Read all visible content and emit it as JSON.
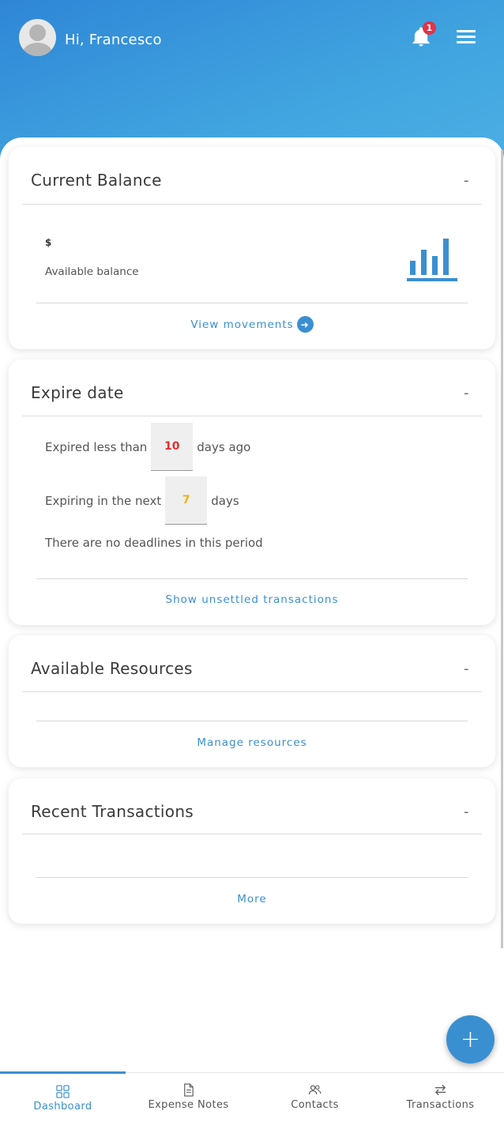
{
  "header": {
    "greeting": "Hi, Francesco",
    "notification_count": "1"
  },
  "balance_card": {
    "title": "Current Balance",
    "collapse": "-",
    "currency": "$",
    "available_label": "Available balance",
    "link": "View movements"
  },
  "expire_card": {
    "title": "Expire date",
    "collapse": "-",
    "expired_prefix": "Expired less than",
    "expired_value": "10",
    "expired_suffix": "days ago",
    "expiring_prefix": "Expiring in the next",
    "expiring_value": "7",
    "expiring_suffix": "days",
    "no_deadlines": "There are no deadlines in this period",
    "link": "Show unsettled transactions"
  },
  "resources_card": {
    "title": "Available Resources",
    "collapse": "-",
    "link": "Manage resources"
  },
  "transactions_card": {
    "title": "Recent Transactions",
    "collapse": "-",
    "link": "More"
  },
  "fab": {
    "label": "+"
  },
  "tabs": [
    {
      "label": "Dashboard",
      "icon": "grid-icon",
      "active": true
    },
    {
      "label": "Expense Notes",
      "icon": "document-icon",
      "active": false
    },
    {
      "label": "Contacts",
      "icon": "people-icon",
      "active": false
    },
    {
      "label": "Transactions",
      "icon": "swap-arrows-icon",
      "active": false
    }
  ],
  "colors": {
    "accent": "#3a8fd0",
    "header_gradient_start": "#2f86d6",
    "header_gradient_end": "#4fb0e3",
    "badge": "#e0344a",
    "expired_value": "#e03030",
    "expiring_value": "#e8b41a"
  }
}
